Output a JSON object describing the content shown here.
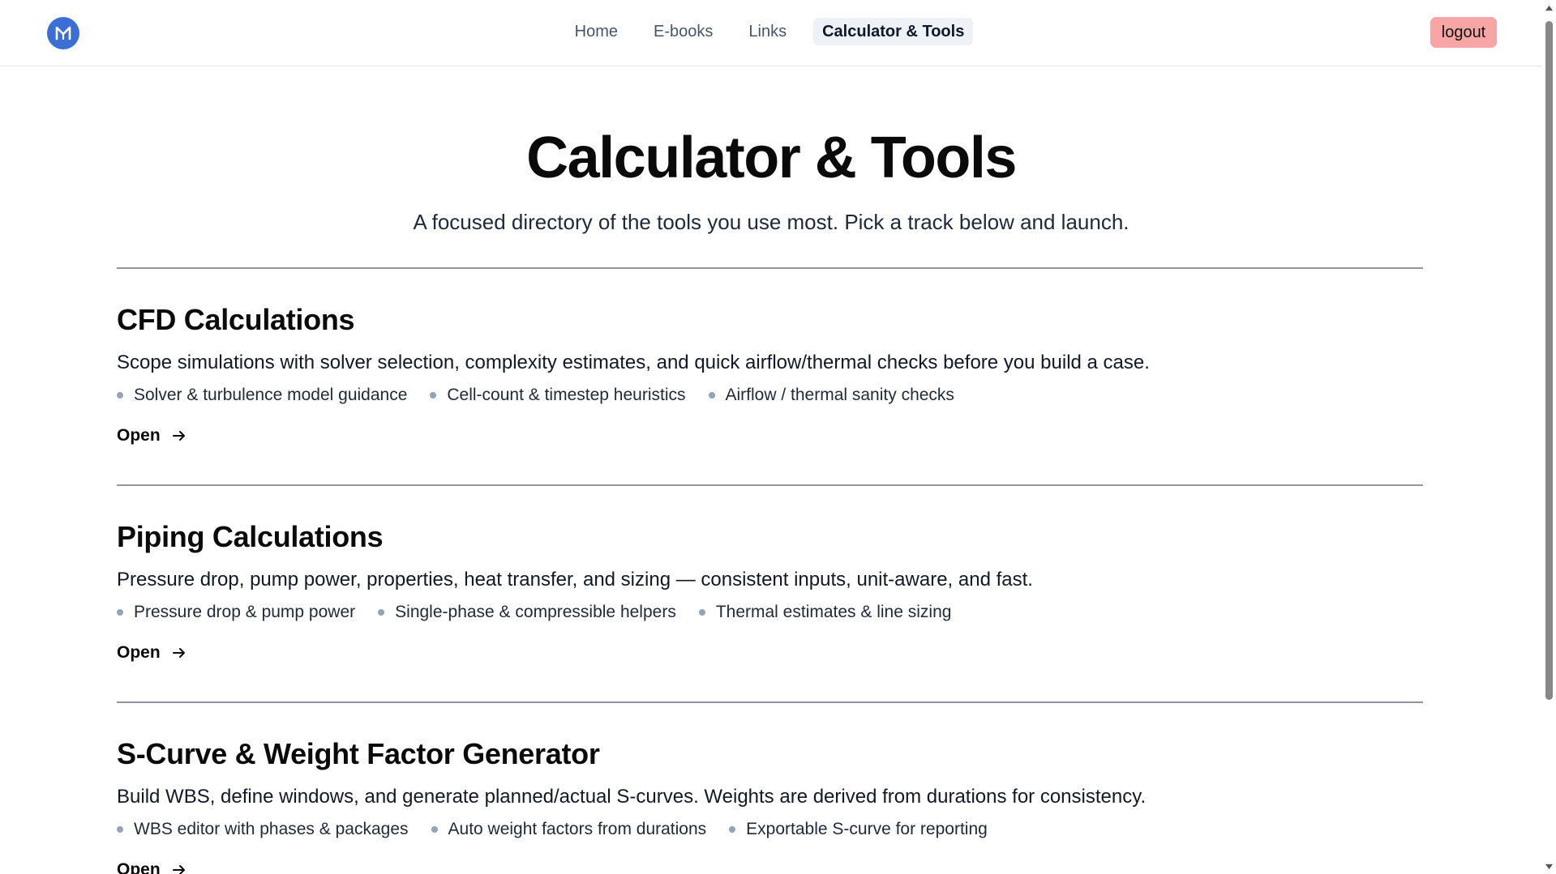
{
  "header": {
    "logo_icon": "brand-logo-icon",
    "nav": [
      {
        "label": "Home"
      },
      {
        "label": "E-books"
      },
      {
        "label": "Links"
      },
      {
        "label": "Calculator & Tools"
      }
    ],
    "active_nav": "Calculator & Tools",
    "logout_label": "logout"
  },
  "hero": {
    "title": "Calculator & Tools",
    "subtitle": "A focused directory of the tools you use most. Pick a track below and launch."
  },
  "sections": [
    {
      "title": "CFD Calculations",
      "description": "Scope simulations with solver selection, complexity estimates, and quick airflow/thermal checks before you build a case.",
      "features": [
        "Solver & turbulence model guidance",
        "Cell-count & timestep heuristics",
        "Airflow / thermal sanity checks"
      ],
      "link_label": "Open"
    },
    {
      "title": "Piping Calculations",
      "description": "Pressure drop, pump power, properties, heat transfer, and sizing — consistent inputs, unit-aware, and fast.",
      "features": [
        "Pressure drop & pump power",
        "Single-phase & compressible helpers",
        "Thermal estimates & line sizing"
      ],
      "link_label": "Open"
    },
    {
      "title": "S-Curve & Weight Factor Generator",
      "description": "Build WBS, define windows, and generate planned/actual S-curves. Weights are derived from durations for consistency.",
      "features": [
        "WBS editor with phases & packages",
        "Auto weight factors from durations",
        "Exportable S-curve for reporting"
      ],
      "link_label": "Open"
    }
  ],
  "colors": {
    "brand": "#3b6fd6",
    "logout_bg": "#f7a5a5",
    "active_nav_bg": "#eef2f7"
  }
}
